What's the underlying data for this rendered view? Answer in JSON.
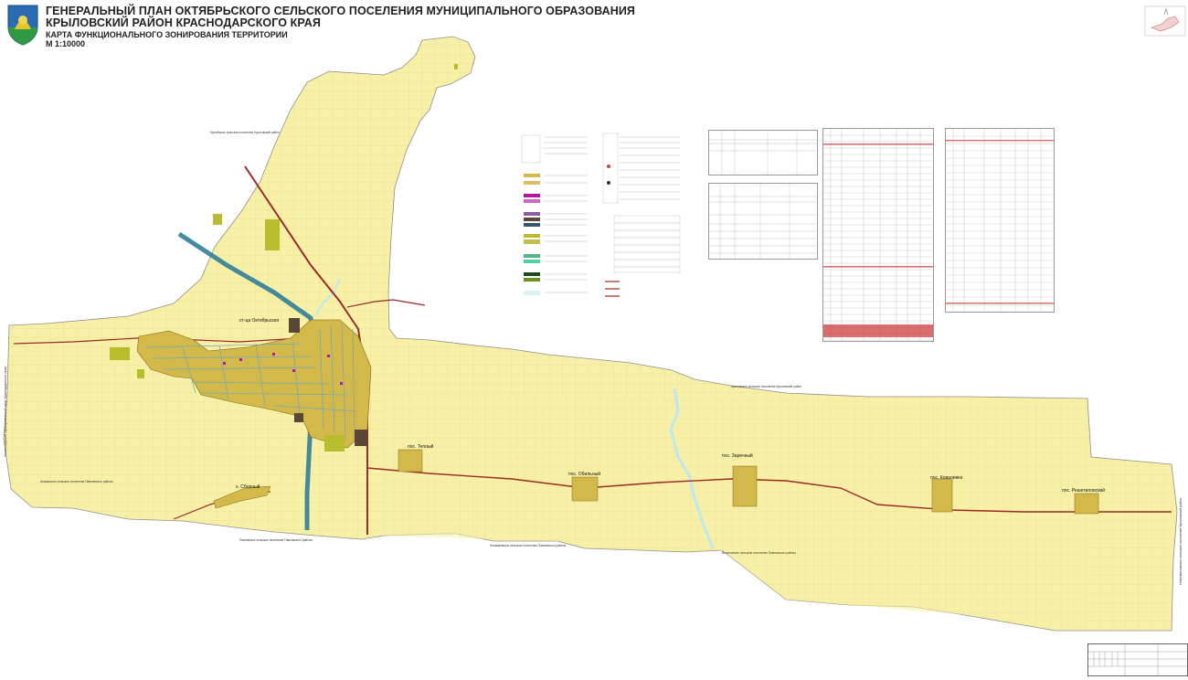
{
  "header": {
    "title_line1": "ГЕНЕРАЛЬНЫЙ ПЛАН ОКТЯБРЬСКОГО СЕЛЬСКОГО ПОСЕЛЕНИЯ МУНИЦИПАЛЬНОГО ОБРАЗОВАНИЯ",
    "title_line2": "КРЫЛОВСКИЙ РАЙОН КРАСНОДАРСКОГО КРАЯ",
    "subtitle": "КАРТА ФУНКЦИОНАЛЬНОГО ЗОНИРОВАНИЯ ТЕРРИТОРИИ",
    "scale": "М 1:10000"
  },
  "settlements": {
    "oktyabrskaya": "ст-ца Октябрьская",
    "sborny": "х. Сборный",
    "teply": "пос. Теплый",
    "obilny": "пос. Обильный",
    "zarechny": "пос. Заречный",
    "kovalevka": "пос. Ковалевка",
    "reshetilovsky": "пос. Решетиловский"
  },
  "neighbors": {
    "kugoey": "Кугоейское сельское поселение Крыловский район",
    "krylovskoe": "Крыловское сельское поселение Крыловский район",
    "novopashkovskoe": "Новопашковское сельское поселение Крыловский район",
    "leningradsky": "Ленинградский муниципальный округ Краснодарского края",
    "atamanskoe": "Атаманское сельское поселение Павловского района",
    "pavlovskoe": "Павловское сельское поселение Павловского района",
    "nezamaevskoe": "Незамаевское сельское поселение Павловского района",
    "veselovskoe": "Веселовское сельское поселение Павловского района",
    "novoleushkovskoe": "Новолеушковское сельское поселение Павловского района"
  },
  "colors": {
    "territory": "#f8f0a6",
    "agriculture": "#f1e79a",
    "residential": "#d2b94a",
    "forest": "#b7bd2c",
    "road": "#9c2a28",
    "rail": "#2f7f9a",
    "boundary": "#8f8f8f",
    "water": "#d9f2f6",
    "industrial": "#5b4636",
    "public": "#b3169f"
  },
  "icons": {
    "emblem": "coat-of-arms-icon",
    "north": "location-inset-icon"
  }
}
